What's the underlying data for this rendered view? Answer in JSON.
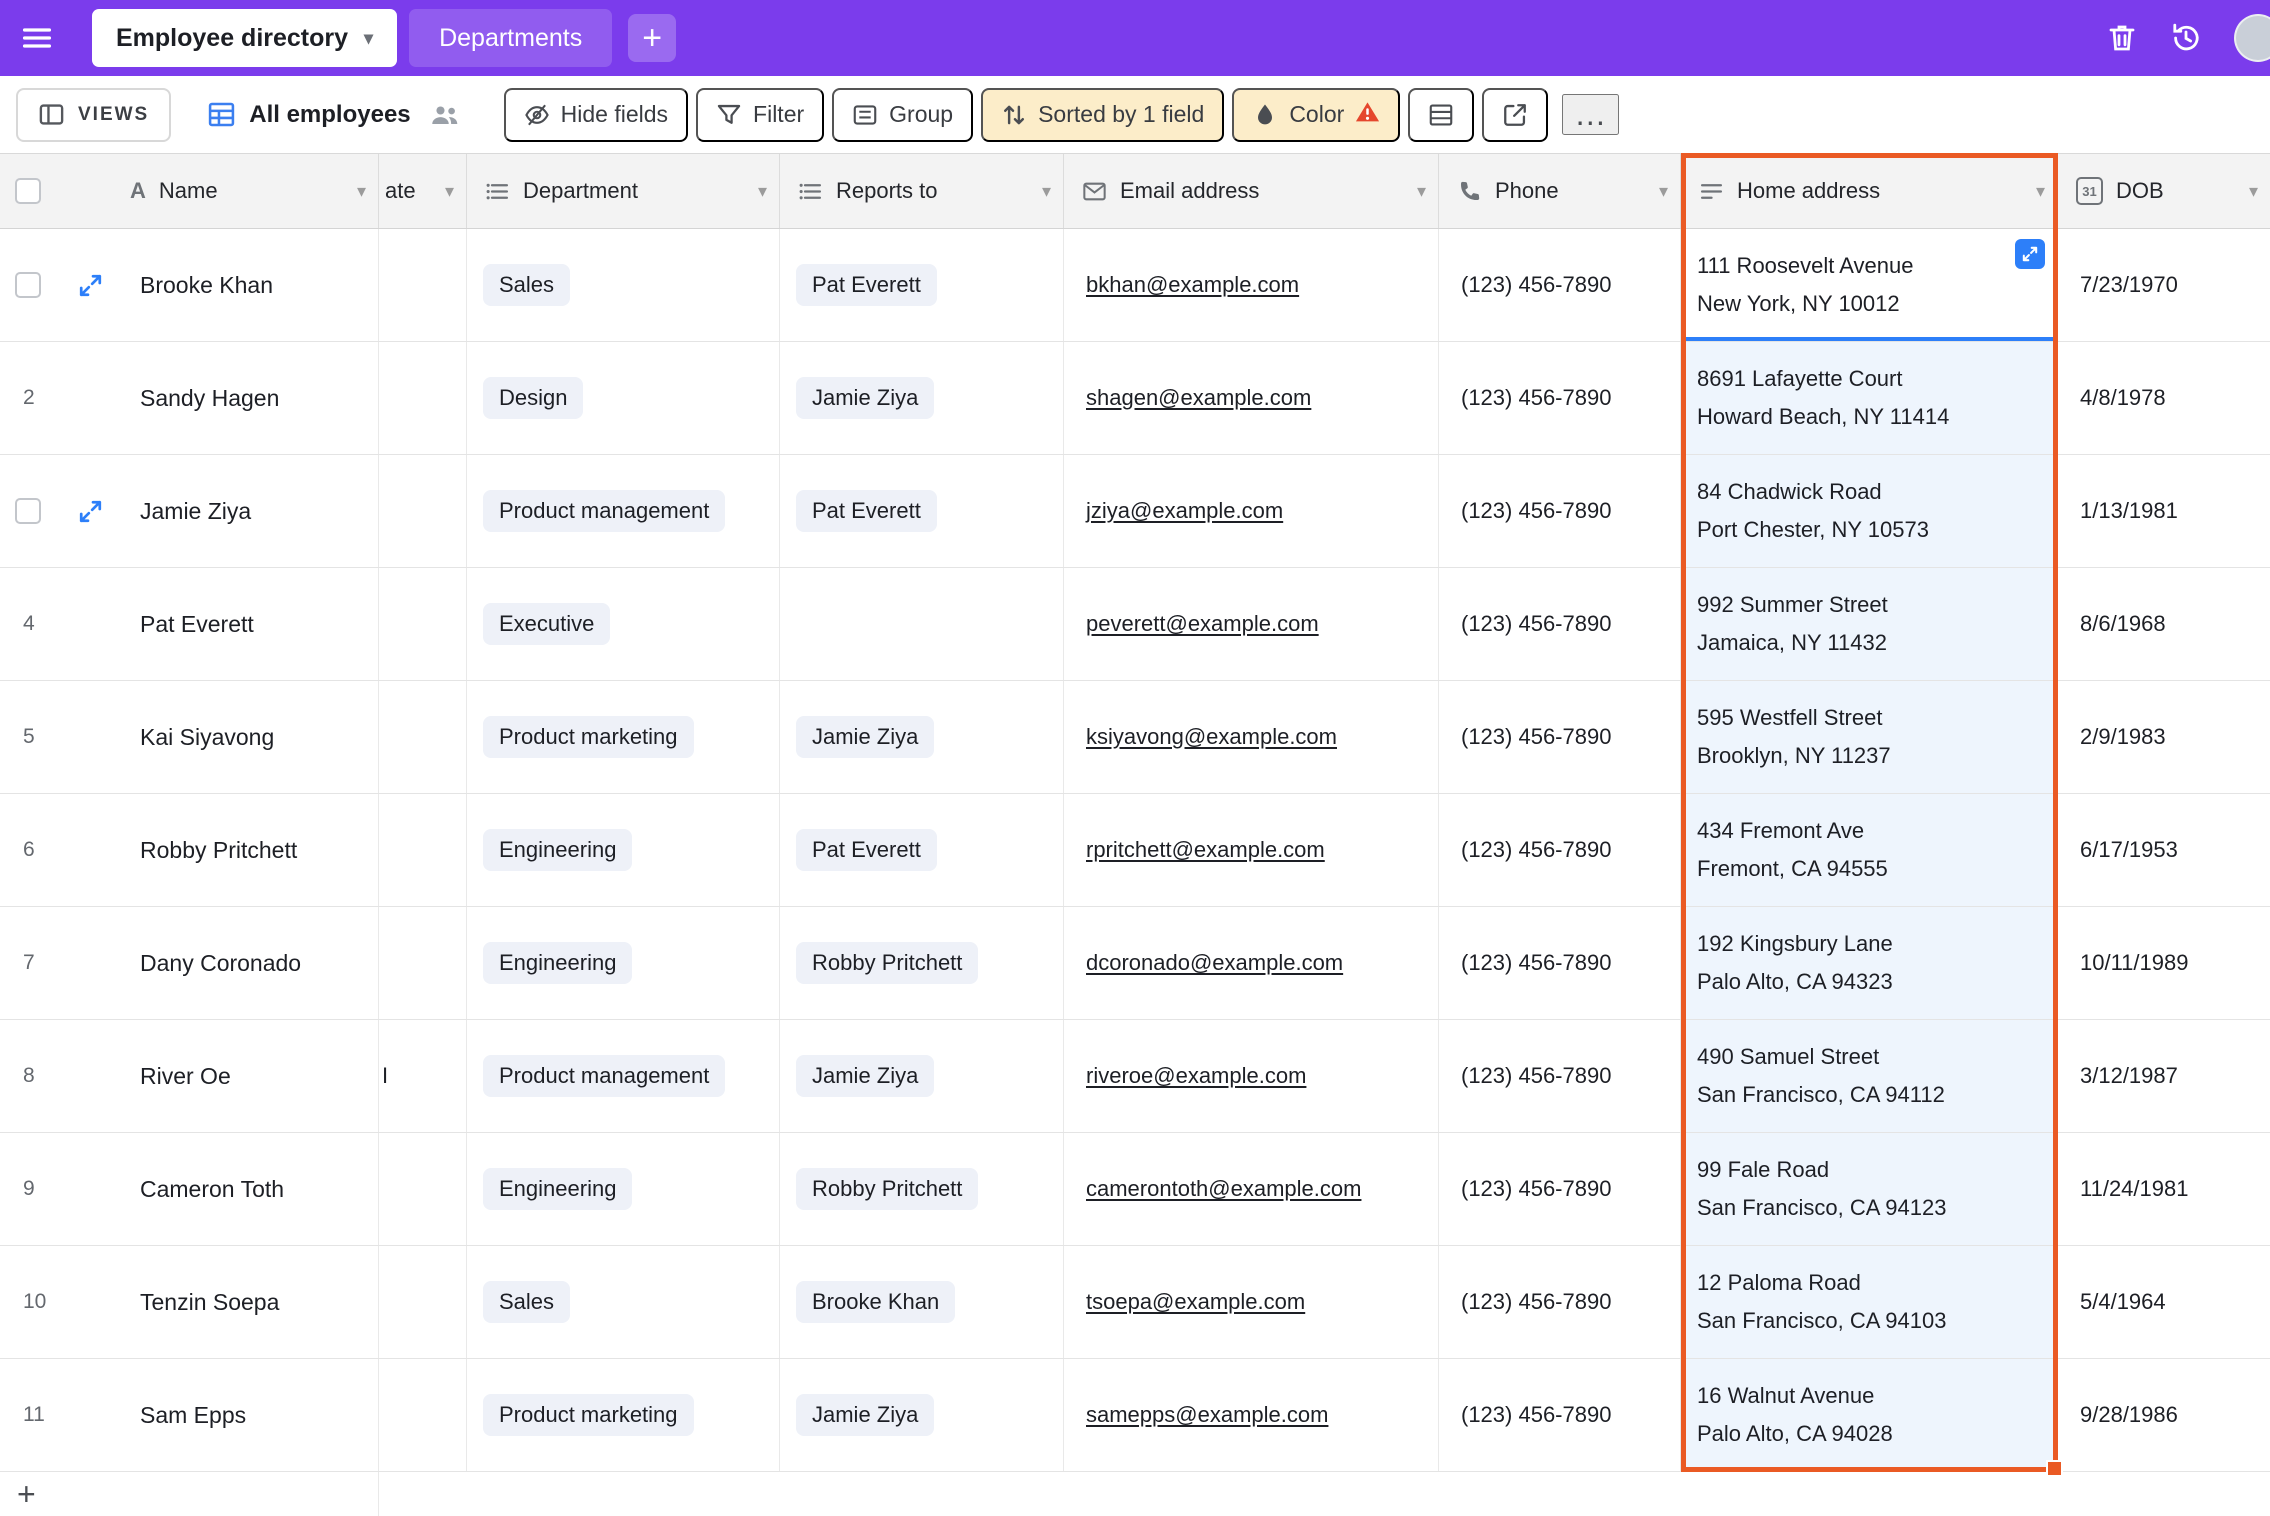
{
  "colors": {
    "topbar_purple": "#7b3cec",
    "selection_blue": "#2d7ff9",
    "highlight_orange": "#ea5a24",
    "pill_bg": "#eef1f8",
    "sorted_bg": "#fcedc9",
    "address_bg": "#eef5fd",
    "warning": "#e5472d"
  },
  "icons": {
    "text_field_glyph": "A"
  },
  "topbar": {
    "tabs": [
      {
        "label": "Employee directory"
      },
      {
        "label": "Departments"
      }
    ],
    "add_tab": "+"
  },
  "toolbar": {
    "views": "VIEWS",
    "view_name": "All employees",
    "hide_fields": "Hide fields",
    "filter": "Filter",
    "group": "Group",
    "sorted": "Sorted by 1 field",
    "color": "Color",
    "more": "…"
  },
  "table": {
    "columns": {
      "name": "Name",
      "partial": "ate",
      "department": "Department",
      "reports_to": "Reports to",
      "email": "Email address",
      "phone": "Phone",
      "address": "Home address",
      "dob": "DOB",
      "calendar_icon_text": "31"
    },
    "add_row": "+",
    "rows": [
      {
        "name": "Brooke Khan",
        "partial": "",
        "department": "Sales",
        "reports_to": "Pat Everett",
        "email": "bkhan@example.com",
        "phone": "(123) 456-7890",
        "address1": "111 Roosevelt Avenue",
        "address2": "New York, NY 10012",
        "dob": "7/23/1970",
        "show_checkbox": true,
        "address_selected": true
      },
      {
        "num": "2",
        "name": "Sandy Hagen",
        "partial": "",
        "department": "Design",
        "reports_to": "Jamie Ziya",
        "email": "shagen@example.com",
        "phone": "(123) 456-7890",
        "address1": "8691 Lafayette Court",
        "address2": "Howard Beach, NY 11414",
        "dob": "4/8/1978"
      },
      {
        "name": "Jamie Ziya",
        "partial": "",
        "department": "Product management",
        "reports_to": "Pat Everett",
        "email": "jziya@example.com",
        "phone": "(123) 456-7890",
        "address1": "84 Chadwick Road",
        "address2": "Port Chester, NY 10573",
        "dob": "1/13/1981",
        "show_checkbox": true
      },
      {
        "num": "4",
        "name": "Pat Everett",
        "partial": "",
        "department": "Executive",
        "reports_to": "",
        "email": "peverett@example.com",
        "phone": "(123) 456-7890",
        "address1": "992 Summer Street",
        "address2": "Jamaica, NY 11432",
        "dob": "8/6/1968"
      },
      {
        "num": "5",
        "name": "Kai Siyavong",
        "partial": "",
        "department": "Product marketing",
        "reports_to": "Jamie Ziya",
        "email": "ksiyavong@example.com",
        "phone": "(123) 456-7890",
        "address1": "595 Westfell Street",
        "address2": "Brooklyn, NY 11237",
        "dob": "2/9/1983"
      },
      {
        "num": "6",
        "name": "Robby Pritchett",
        "partial": "",
        "department": "Engineering",
        "reports_to": "Pat Everett",
        "email": "rpritchett@example.com",
        "phone": "(123) 456-7890",
        "address1": "434 Fremont Ave",
        "address2": "Fremont, CA 94555",
        "dob": "6/17/1953"
      },
      {
        "num": "7",
        "name": "Dany Coronado",
        "partial": "",
        "department": "Engineering",
        "reports_to": "Robby Pritchett",
        "email": "dcoronado@example.com",
        "phone": "(123) 456-7890",
        "address1": "192 Kingsbury Lane",
        "address2": "Palo Alto, CA 94323",
        "dob": "10/11/1989"
      },
      {
        "num": "8",
        "name": "River Oe",
        "partial": "I",
        "department": "Product management",
        "reports_to": "Jamie Ziya",
        "email": "riveroe@example.com",
        "phone": "(123) 456-7890",
        "address1": "490 Samuel Street",
        "address2": "San Francisco, CA 94112",
        "dob": "3/12/1987"
      },
      {
        "num": "9",
        "name": "Cameron Toth",
        "partial": "",
        "department": "Engineering",
        "reports_to": "Robby Pritchett",
        "email": "camerontoth@example.com",
        "phone": "(123) 456-7890",
        "address1": "99 Fale Road",
        "address2": "San Francisco, CA 94123",
        "dob": "11/24/1981"
      },
      {
        "num": "10",
        "name": "Tenzin Soepa",
        "partial": "",
        "department": "Sales",
        "reports_to": "Brooke Khan",
        "email": "tsoepa@example.com",
        "phone": "(123) 456-7890",
        "address1": "12 Paloma Road",
        "address2": "San Francisco, CA 94103",
        "dob": "5/4/1964"
      },
      {
        "num": "11",
        "name": "Sam Epps",
        "partial": "",
        "department": "Product marketing",
        "reports_to": "Jamie Ziya",
        "email": "samepps@example.com",
        "phone": "(123) 456-7890",
        "address1": "16 Walnut Avenue",
        "address2": "Palo Alto, CA 94028",
        "dob": "9/28/1986"
      }
    ]
  }
}
